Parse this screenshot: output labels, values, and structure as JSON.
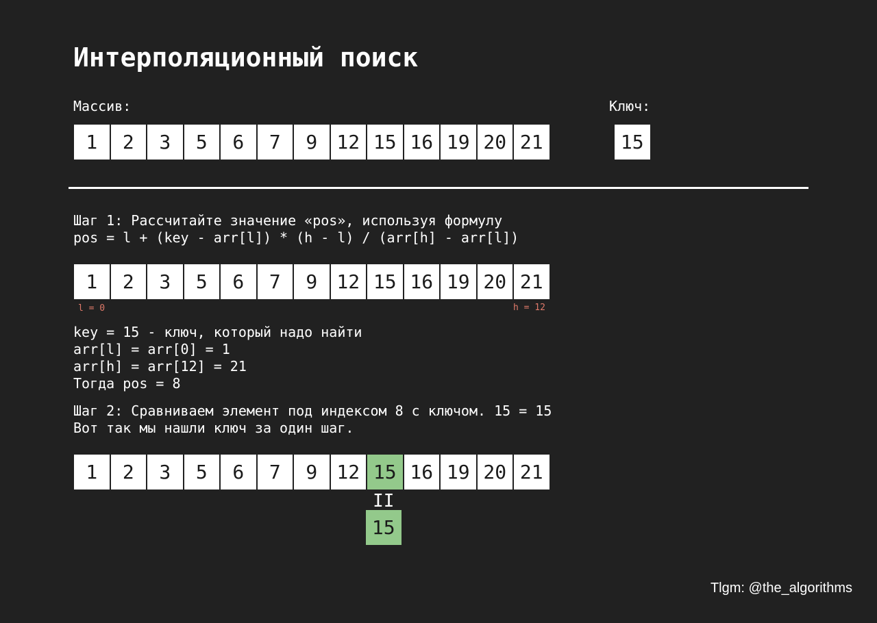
{
  "title": "Интерполяционный поиск",
  "array_label": "Массив:",
  "key_label": "Ключ:",
  "array": [
    "1",
    "2",
    "3",
    "5",
    "6",
    "7",
    "9",
    "12",
    "15",
    "16",
    "19",
    "20",
    "21"
  ],
  "key": "15",
  "step1": {
    "lines": [
      "Шаг 1: Рассчитайте значение «pos», используя формулу",
      "pos = l + (key - arr[l]) * (h - l) / (arr[h] - arr[l])"
    ],
    "low_pointer": "l = 0",
    "high_pointer": "h = 12",
    "explanation": [
      "key = 15 - ключ, который надо найти",
      "arr[l] = arr[0] = 1",
      "arr[h] = arr[12] = 21",
      "Тогда pos = 8"
    ]
  },
  "step2": {
    "lines": [
      "Шаг 2: Сравниваем элемент под индексом 8 с ключом. 15 = 15",
      "Вот так мы нашли ключ за один шаг."
    ],
    "found_index": 8,
    "equals_sign": "II",
    "key_value": "15"
  },
  "watermark": "Tlgm: @the_algorithms",
  "colors": {
    "background": "#212121",
    "cell": "#ffffff",
    "found_cell": "#93c98b",
    "pointer": "#e07a6a"
  }
}
